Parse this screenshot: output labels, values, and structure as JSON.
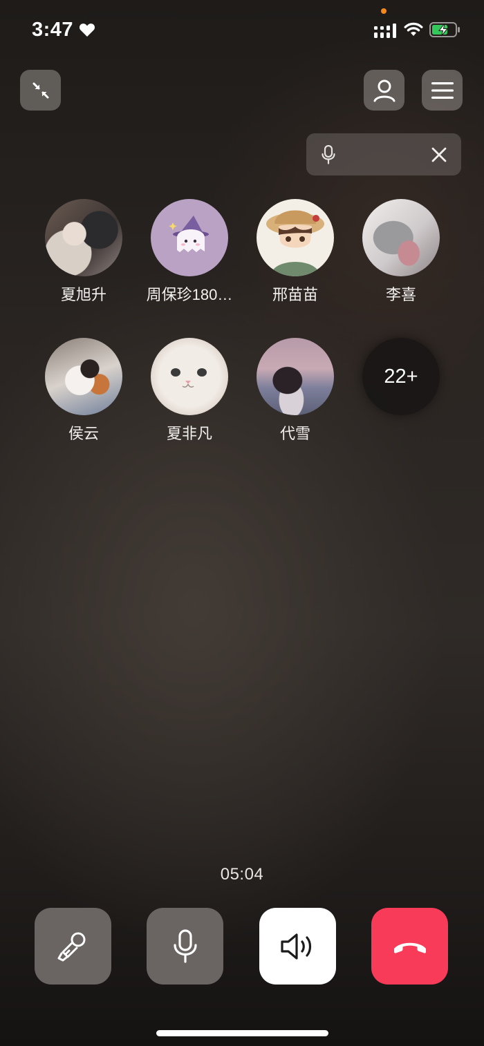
{
  "status_bar": {
    "time": "3:47",
    "heart_icon": "heart-icon",
    "signal_icon": "signal-icon",
    "wifi_icon": "wifi-icon",
    "battery_icon": "battery-charging-icon",
    "privacy_dot_color": "#f5891d"
  },
  "toolbar": {
    "minimize_icon": "minimize-arrows-icon",
    "profile_icon": "person-icon",
    "menu_icon": "menu-icon"
  },
  "voice_pill": {
    "mic_icon": "microphone-icon",
    "close_icon": "close-icon"
  },
  "participants": [
    {
      "name": "夏旭升"
    },
    {
      "name": "周保珍180…"
    },
    {
      "name": "邢苗苗"
    },
    {
      "name": "李喜"
    },
    {
      "name": "侯云"
    },
    {
      "name": "夏非凡"
    },
    {
      "name": "代雪"
    }
  ],
  "more_participants": "22+",
  "call": {
    "timer": "05:04"
  },
  "controls": {
    "effects_icon": "effects-icon",
    "mute_icon": "microphone-icon",
    "speaker_icon": "speaker-icon",
    "hangup_icon": "hang-up-icon",
    "hangup_color": "#f73b58"
  }
}
